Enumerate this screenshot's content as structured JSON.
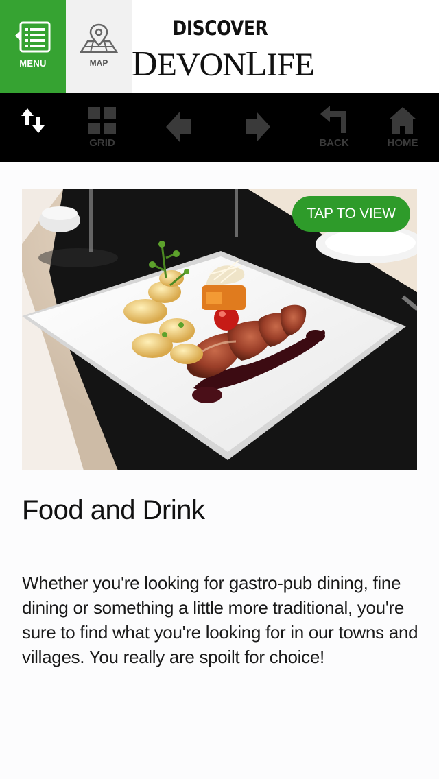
{
  "header": {
    "menu_label": "MENU",
    "map_label": "MAP",
    "logo_top": "DISCOVER",
    "logo_bottom_part1": "D",
    "logo_bottom_part2": "EVON",
    "logo_bottom_part3": "L",
    "logo_bottom_part4": "IFE",
    "accent_color": "#36a332"
  },
  "toolbar": {
    "items": [
      {
        "icon": "sort-arrows-icon",
        "label": ""
      },
      {
        "icon": "grid-icon",
        "label": "GRID"
      },
      {
        "icon": "arrow-left-icon",
        "label": ""
      },
      {
        "icon": "arrow-right-icon",
        "label": ""
      },
      {
        "icon": "back-icon",
        "label": "BACK"
      },
      {
        "icon": "home-icon",
        "label": "HOME"
      }
    ]
  },
  "content": {
    "tap_button_label": "TAP TO VIEW",
    "title": "Food and Drink",
    "description": "Whether you're looking for gastro-pub dining, fine dining or something a little more traditional, you're sure to find what you're looking for in our towns and villages. You really are spoilt for choice!"
  }
}
